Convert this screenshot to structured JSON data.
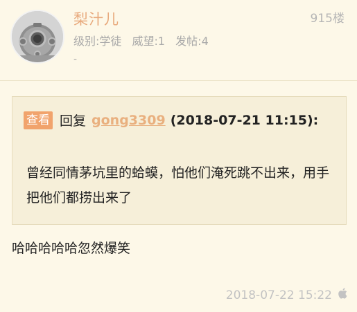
{
  "post": {
    "username": "梨汁儿",
    "floor": "915楼",
    "meta": {
      "level": "级别:学徒",
      "prestige": "威望:1",
      "posts": "发帖:4"
    },
    "signature": "-",
    "quote": {
      "view_label": "查看",
      "reply_word": "回复",
      "reply_user": "gong3309",
      "reply_date": "(2018-07-21 11:15):",
      "text": "曾经同情茅坑里的蛤蟆，怕他们淹死跳不出来，用手把他们都捞出来了"
    },
    "content": "哈哈哈哈哈忽然爆笑",
    "timestamp": "2018-07-22 15:22",
    "device_icon": "apple-icon"
  },
  "colors": {
    "background": "#fdf8e8",
    "username": "#e8a97c",
    "view_button": "#f1a36c",
    "reply_user": "#e9b07f",
    "quote_background": "#f6efd9",
    "muted_text": "#a9a9a9"
  }
}
